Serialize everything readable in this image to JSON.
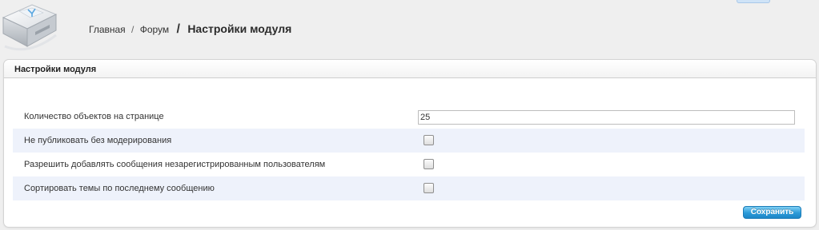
{
  "breadcrumb": {
    "home": "Главная",
    "separator": "/",
    "forum": "Форум",
    "big_separator": "/",
    "current": "Настройки модуля"
  },
  "panel": {
    "title": "Настройки модуля"
  },
  "settings": [
    {
      "label": "Количество объектов на странице",
      "type": "text",
      "value": "25"
    },
    {
      "label": "Не публиковать без модерирования",
      "type": "checkbox",
      "checked": false
    },
    {
      "label": "Разрешить добавлять сообщения незарегистрированным пользователям",
      "type": "checkbox",
      "checked": false
    },
    {
      "label": "Сортировать темы по последнему сообщению",
      "type": "checkbox",
      "checked": false
    }
  ],
  "buttons": {
    "save_label": "Сохранить"
  },
  "icons": {
    "logo": "router-device-icon",
    "checkbox": "checkbox-unchecked-icon"
  },
  "colors": {
    "row_alt_bg": "#eef2fb",
    "save_button": "#2b9ad8"
  }
}
